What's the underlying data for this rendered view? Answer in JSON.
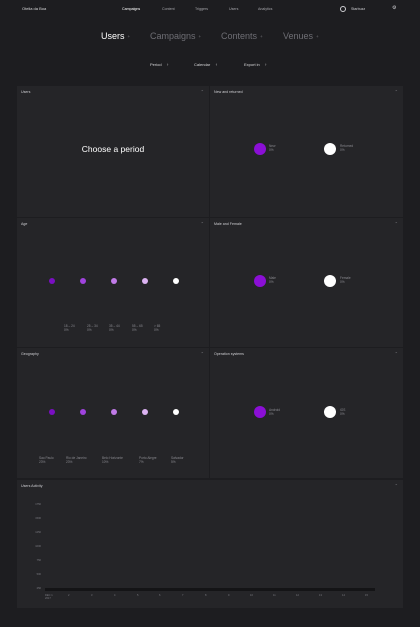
{
  "header": {
    "brand": "Otelia da Boa",
    "nav": [
      "Campaigns",
      "Content",
      "Triggers",
      "Users",
      "Analytics"
    ],
    "active_nav": "Campaigns",
    "profile_name": "Starbuzz",
    "profile_icon": "user-icon",
    "settings_icon": "gear-icon"
  },
  "tabs": [
    {
      "label": "Users",
      "plus": "+"
    },
    {
      "label": "Campaigns",
      "plus": "+"
    },
    {
      "label": "Contents",
      "plus": "+"
    },
    {
      "label": "Venues",
      "plus": "+"
    }
  ],
  "controls": [
    {
      "label": "Period",
      "arrow": "↑"
    },
    {
      "label": "Calendar",
      "arrow": "↑"
    },
    {
      "label": "Export in",
      "arrow": "↑"
    }
  ],
  "cards": {
    "users": {
      "title": "Users",
      "caret": "⌃",
      "message": "Choose a period"
    },
    "new_returned": {
      "title": "New and returned",
      "caret": "⌃",
      "items": [
        {
          "label": "New",
          "value": "0%",
          "color": "#8b0fd6"
        },
        {
          "label": "Returned",
          "value": "0%",
          "color": "#ffffff"
        }
      ]
    },
    "age": {
      "title": "Age",
      "caret": "⌃",
      "items": [
        {
          "label": "18 – 24",
          "value": "0%",
          "color": "#7a0fc2"
        },
        {
          "label": "25 – 34",
          "value": "0%",
          "color": "#a043de"
        },
        {
          "label": "35 – 44",
          "value": "0%",
          "color": "#c17be8"
        },
        {
          "label": "55 – 65",
          "value": "0%",
          "color": "#dcb3f2"
        },
        {
          "label": "> 65",
          "value": "0%",
          "color": "#ffffff"
        }
      ]
    },
    "gender": {
      "title": "Male and Female",
      "caret": "⌃",
      "items": [
        {
          "label": "Male",
          "value": "0%",
          "color": "#8b0fd6"
        },
        {
          "label": "Female",
          "value": "0%",
          "color": "#ffffff"
        }
      ]
    },
    "geography": {
      "title": "Geography",
      "caret": "⌃",
      "items": [
        {
          "label": "Sao Paulo",
          "value": "23%",
          "color": "#7a0fc2"
        },
        {
          "label": "Rio de Janeiro",
          "value": "23%",
          "color": "#a043de"
        },
        {
          "label": "Belo Horizonte",
          "value": "10%",
          "color": "#c17be8"
        },
        {
          "label": "Porto Alegre",
          "value": "7%",
          "color": "#dcb3f2"
        },
        {
          "label": "Salvador",
          "value": "5%",
          "color": "#ffffff"
        }
      ]
    },
    "os": {
      "title": "Operation systems",
      "caret": "⌃",
      "items": [
        {
          "label": "Android",
          "value": "0%",
          "color": "#8b0fd6"
        },
        {
          "label": "iOS",
          "value": "0%",
          "color": "#ffffff"
        }
      ]
    },
    "activity": {
      "title": "Users Activity",
      "caret": "⌃",
      "y_ticks": [
        "1750",
        "1500",
        "1250",
        "1000",
        "750",
        "500",
        "250",
        "0"
      ],
      "x_ticks": [
        "DEC 1 2017",
        "2",
        "3",
        "4",
        "5",
        "6",
        "7",
        "8",
        "9",
        "10",
        "11",
        "12",
        "13",
        "14",
        "15"
      ]
    }
  }
}
